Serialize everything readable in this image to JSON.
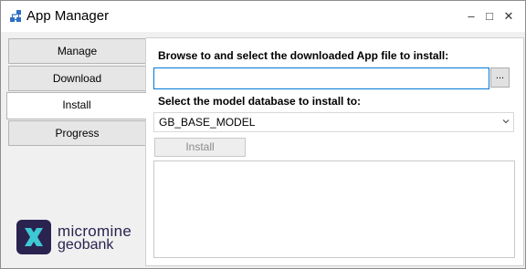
{
  "window": {
    "title": "App Manager",
    "icon": "network-nodes-icon",
    "controls": {
      "minimize": "–",
      "maximize": "□",
      "close": "✕"
    }
  },
  "tabs": [
    {
      "label": "Manage",
      "active": false
    },
    {
      "label": "Download",
      "active": false
    },
    {
      "label": "Install",
      "active": true
    },
    {
      "label": "Progress",
      "active": false
    }
  ],
  "install": {
    "browse_label": "Browse to and select the downloaded App file to install:",
    "file_path_value": "",
    "browse_button_label": "...",
    "database_label": "Select the model database to install to:",
    "database_selected": "GB_BASE_MODEL",
    "install_button_label": "Install",
    "install_button_enabled": false,
    "log_text": ""
  },
  "branding": {
    "line1": "micromine",
    "line2": "geobank",
    "accent_color": "#2a2350",
    "mark_color": "#3ec8d4"
  }
}
